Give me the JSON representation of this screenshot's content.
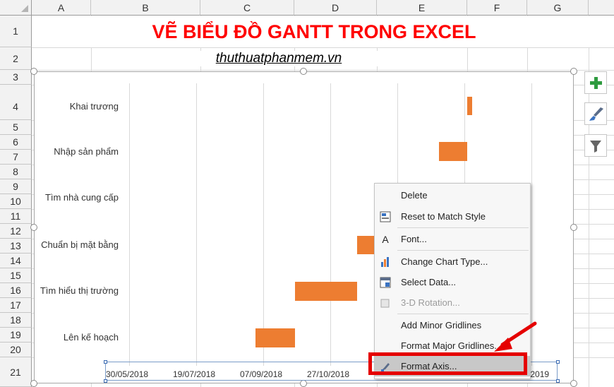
{
  "spreadsheet": {
    "columns": [
      "A",
      "B",
      "C",
      "D",
      "E",
      "F",
      "G"
    ],
    "rows": [
      "1",
      "2",
      "3",
      "4",
      "5",
      "6",
      "7",
      "8",
      "9",
      "10",
      "11",
      "12",
      "13",
      "14",
      "15",
      "16",
      "17",
      "18",
      "19",
      "20",
      "21"
    ]
  },
  "title": "VẼ BIỂU ĐỒ GANTT TRONG EXCEL",
  "subtitle": "thuthuatphanmem.vn",
  "chart_data": {
    "type": "bar",
    "orientation": "horizontal",
    "categories": [
      "Khai trương",
      "Nhập sản phẩm",
      "Tìm nhà cung cấp",
      "Chuẩn bị mặt bằng",
      "Tìm hiểu thị trường",
      "Lên kế hoạch"
    ],
    "x_tick_labels": [
      "30/05/2018",
      "19/07/2018",
      "07/09/2018",
      "27/10/2018",
      "",
      "",
      "20/__/2019"
    ],
    "bar_color": "#ed7d31",
    "grid": true
  },
  "side_buttons": [
    "plus-icon",
    "brush-icon",
    "filter-icon"
  ],
  "context_menu": {
    "items": [
      {
        "label": "Delete",
        "icon": ""
      },
      {
        "label": "Reset to Match Style",
        "icon": "reset-style-icon"
      },
      {
        "label": "Font...",
        "icon": "font-icon"
      },
      {
        "label": "Change Chart Type...",
        "icon": "chart-type-icon"
      },
      {
        "label": "Select Data...",
        "icon": "select-data-icon"
      },
      {
        "label": "3-D Rotation...",
        "icon": "rotation-icon"
      },
      {
        "label": "Add Minor Gridlines",
        "icon": ""
      },
      {
        "label": "Format Major Gridlines...",
        "icon": ""
      },
      {
        "label": "Format Axis...",
        "icon": "format-axis-icon"
      }
    ]
  },
  "colors": {
    "title": "#ff0000",
    "bar": "#ed7d31",
    "highlight": "#e50000",
    "plus": "#2e9b3f"
  }
}
